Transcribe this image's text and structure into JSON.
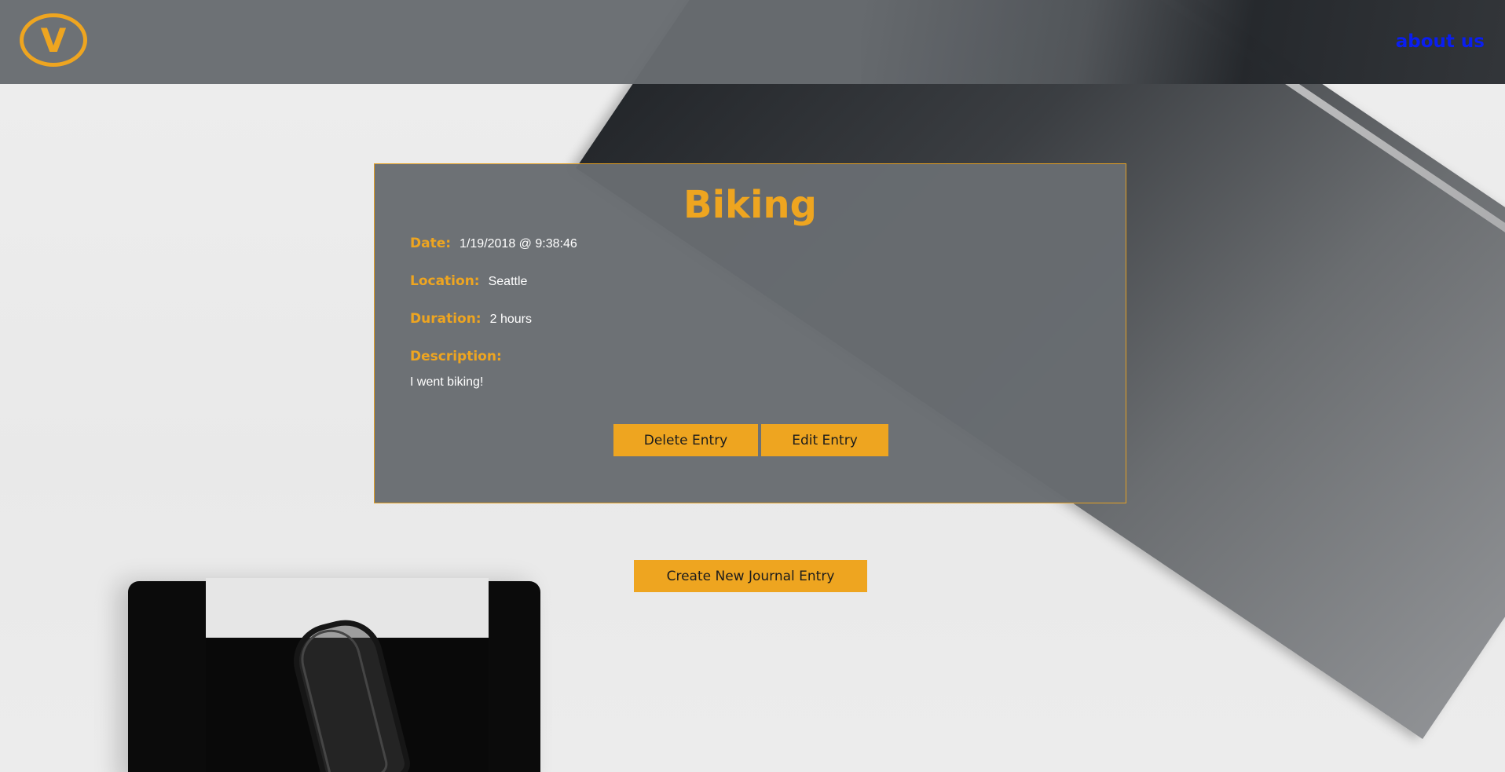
{
  "header": {
    "logo_letter": "V",
    "about_label": "about us"
  },
  "entry": {
    "title": "Biking",
    "date_label": "Date:",
    "date_value": "1/19/2018 @ 9:38:46",
    "location_label": "Location:",
    "location_value": "Seattle",
    "duration_label": "Duration:",
    "duration_value": "2 hours",
    "description_label": "Description:",
    "description_value": "I went biking!",
    "delete_label": "Delete Entry",
    "edit_label": "Edit Entry"
  },
  "create_label": "Create New Journal Entry",
  "colors": {
    "accent": "#eea520",
    "panel": "#686c71",
    "link": "#0a1ef0"
  }
}
